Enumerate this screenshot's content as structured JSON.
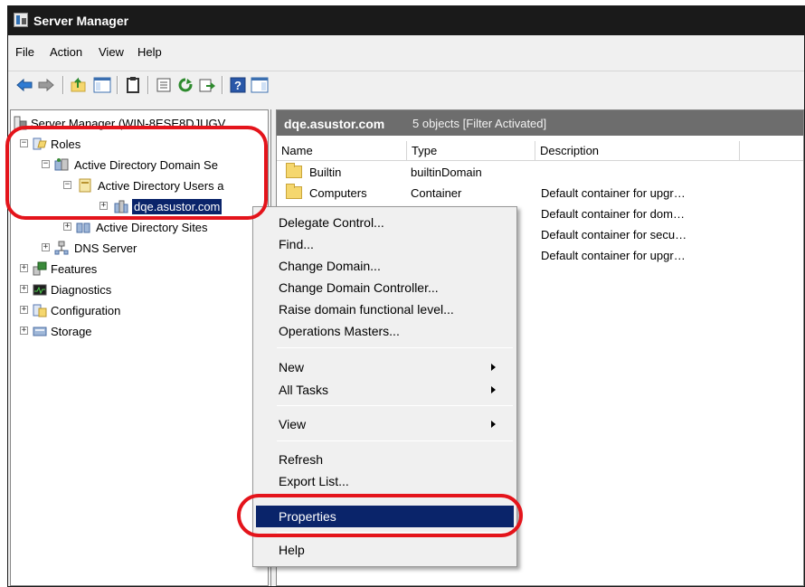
{
  "window": {
    "title": "Server Manager"
  },
  "menu": [
    "File",
    "Action",
    "View",
    "Help"
  ],
  "toolbar": [
    "back-icon",
    "forward-icon",
    "up-icon",
    "show-hide-tree-icon",
    "clipboard-icon",
    "properties-icon",
    "refresh-icon",
    "export-icon",
    "help-icon",
    "show-hide-action-pane-icon"
  ],
  "tree": {
    "root": "Server Manager (WIN-8ESE8DJUGV",
    "roles": "Roles",
    "ad_ds": "Active Directory Domain Se",
    "ad_users": "Active Directory Users a",
    "domain": "dqe.asustor.com",
    "ad_sites": "Active Directory Sites",
    "dns": "DNS Server",
    "features": "Features",
    "diagnostics": "Diagnostics",
    "configuration": "Configuration",
    "storage": "Storage"
  },
  "list": {
    "domain": "dqe.asustor.com",
    "status": "5 objects  [Filter Activated]",
    "columns": [
      "Name",
      "Type",
      "Description"
    ],
    "rows": [
      {
        "name": "Builtin",
        "type": "builtinDomain",
        "description": ""
      },
      {
        "name": "Computers",
        "type": "Container",
        "description": "Default container for upgr…"
      },
      {
        "name": "",
        "type": "…",
        "description": "Default container for dom…"
      },
      {
        "name": "",
        "type": "",
        "description": "Default container for secu…"
      },
      {
        "name": "",
        "type": "",
        "description": "Default container for upgr…"
      }
    ]
  },
  "context_menu": {
    "delegate": "Delegate Control...",
    "find": "Find...",
    "change_domain": "Change Domain...",
    "change_dc": "Change Domain Controller...",
    "raise_level": "Raise domain functional level...",
    "operations_masters": "Operations Masters...",
    "new": "New",
    "all_tasks": "All Tasks",
    "view": "View",
    "refresh": "Refresh",
    "export_list": "Export List...",
    "properties": "Properties",
    "help": "Help"
  },
  "colors": {
    "selection": "#0a246a",
    "annotation": "#e4141b",
    "header_band": "#6d6d6d"
  }
}
